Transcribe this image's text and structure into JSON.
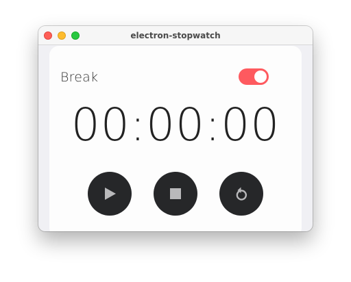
{
  "window": {
    "title": "electron-stopwatch"
  },
  "stopwatch": {
    "mode_label": "Break",
    "mode_toggle_on": true,
    "time": "00:00:00"
  },
  "controls": {
    "play_icon": "play-icon",
    "stop_icon": "stop-icon",
    "reset_icon": "reset-icon"
  },
  "colors": {
    "toggle_on": "#fe5a5f",
    "button_bg": "#262729",
    "icon": "#b9b9bb"
  }
}
